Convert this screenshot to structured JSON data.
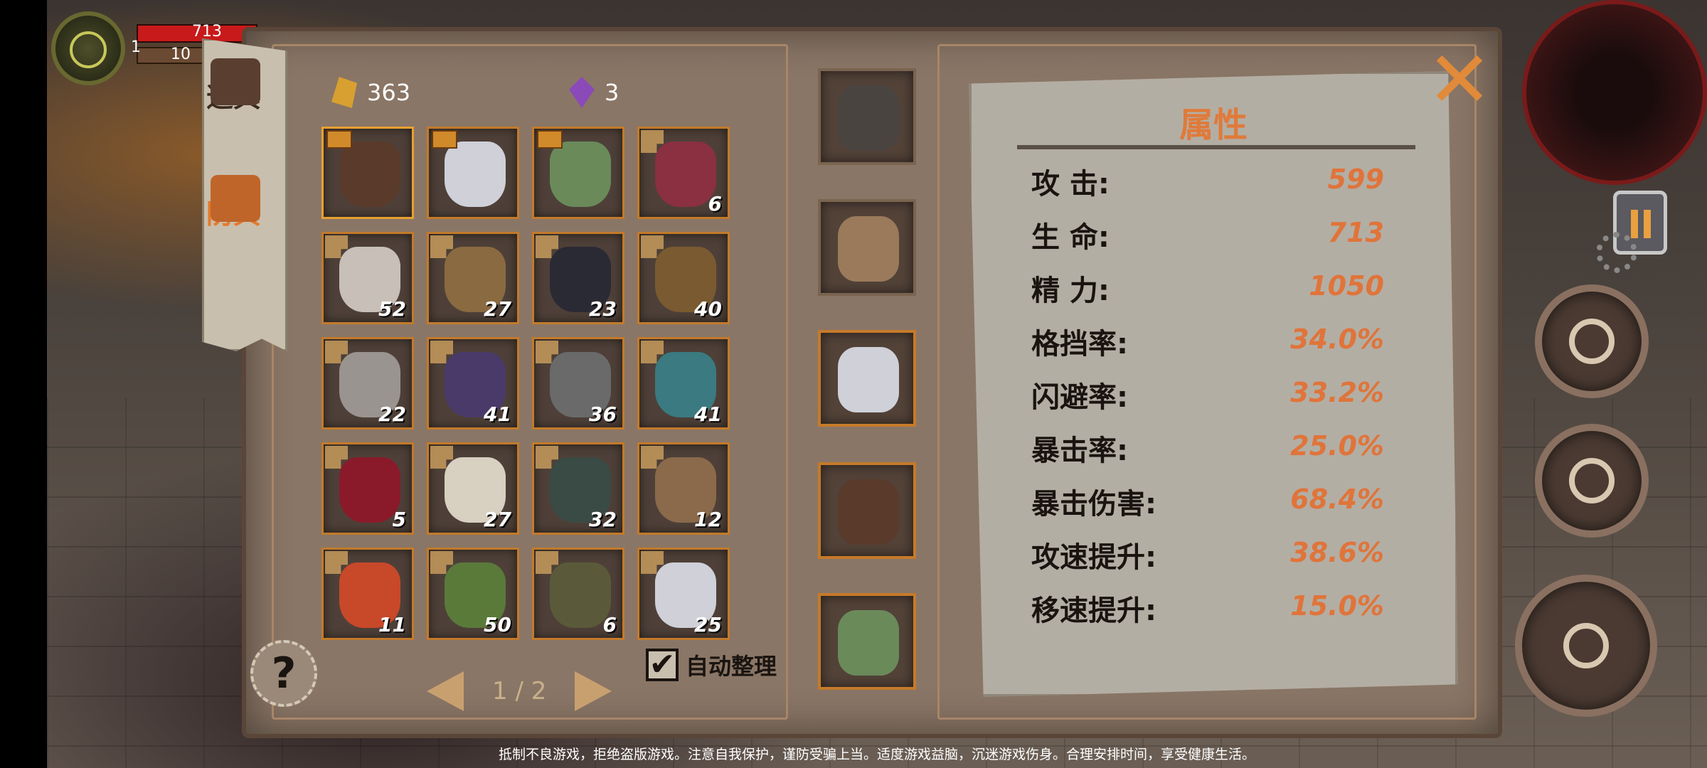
{
  "hud": {
    "level": "1",
    "hp": "713",
    "mp": "10"
  },
  "tabs": [
    {
      "label": "道具",
      "active": false
    },
    {
      "label": "防具",
      "active": true
    }
  ],
  "currency": {
    "gold": "363",
    "gem": "3"
  },
  "inventory": [
    {
      "name": "flame-demon-armor",
      "count": "",
      "color": "#5a3a2a",
      "selected": true,
      "flag": true
    },
    {
      "name": "hooded-mask",
      "count": "",
      "color": "#cfd0d8",
      "flag": true
    },
    {
      "name": "boots",
      "count": "",
      "color": "#6a8a5a",
      "flag": true
    },
    {
      "name": "red-vest",
      "count": "6",
      "color": "#8a3040"
    },
    {
      "name": "bandage-wrap",
      "count": "52",
      "color": "#c8c0b8"
    },
    {
      "name": "claw-gauntlet",
      "count": "27",
      "color": "#8a6a40"
    },
    {
      "name": "dark-coat",
      "count": "23",
      "color": "#2a2a34"
    },
    {
      "name": "fur-shoulder",
      "count": "40",
      "color": "#7a5a30"
    },
    {
      "name": "torn-cloth",
      "count": "22",
      "color": "#9a9490"
    },
    {
      "name": "purple-jacket",
      "count": "41",
      "color": "#4a3a6a"
    },
    {
      "name": "skull-helmet",
      "count": "36",
      "color": "#6a6a6a"
    },
    {
      "name": "teal-armor",
      "count": "41",
      "color": "#3a7a80"
    },
    {
      "name": "red-hood",
      "count": "5",
      "color": "#8a1a2a"
    },
    {
      "name": "silver-crown",
      "count": "27",
      "color": "#d8d0c0"
    },
    {
      "name": "stone-helm",
      "count": "32",
      "color": "#3a4a44"
    },
    {
      "name": "cloth-cap",
      "count": "12",
      "color": "#8a6a4a"
    },
    {
      "name": "fire-cloak",
      "count": "11",
      "color": "#c8482a"
    },
    {
      "name": "moss-armor",
      "count": "50",
      "color": "#5a7a3a"
    },
    {
      "name": "scarab-helm",
      "count": "6",
      "color": "#5a5a3a"
    },
    {
      "name": "hooded-mask-2",
      "count": "25",
      "color": "#cfd0d8"
    }
  ],
  "equipped": [
    {
      "name": "spear",
      "color": "#4a4440"
    },
    {
      "name": "wood-shield",
      "color": "#9a7a5a"
    },
    {
      "name": "hooded-mask",
      "color": "#cfd0d8"
    },
    {
      "name": "flame-demon-armor",
      "color": "#5a3a2a"
    },
    {
      "name": "boots",
      "color": "#6a8a5a"
    }
  ],
  "stats": {
    "title": "属性",
    "rows": [
      {
        "label": "攻  击:",
        "value": "599"
      },
      {
        "label": "生  命:",
        "value": "713"
      },
      {
        "label": "精  力:",
        "value": "1050"
      },
      {
        "label": "格挡率:",
        "value": "34.0%"
      },
      {
        "label": "闪避率:",
        "value": "33.2%"
      },
      {
        "label": "暴击率:",
        "value": "25.0%"
      },
      {
        "label": "暴击伤害:",
        "value": "68.4%"
      },
      {
        "label": "攻速提升:",
        "value": "38.6%"
      },
      {
        "label": "移速提升:",
        "value": "15.0%"
      }
    ]
  },
  "pager": {
    "text": "1 / 2"
  },
  "auto_sort": {
    "label": "自动整理",
    "checked": true,
    "check_glyph": "✔"
  },
  "help_glyph": "?",
  "close_glyph": "✕",
  "notice": "抵制不良游戏，拒绝盗版游戏。注意自我保护，谨防受骗上当。适度游戏益脑，沉迷游戏伤身。合理安排时间，享受健康生活。"
}
